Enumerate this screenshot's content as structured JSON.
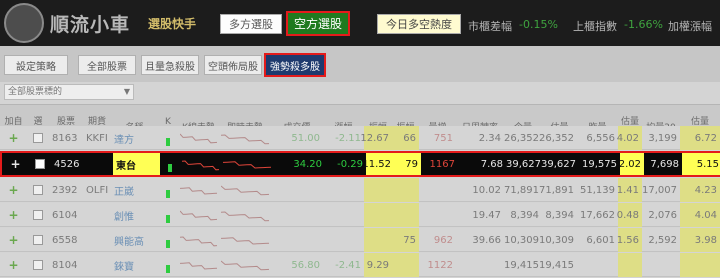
{
  "app": {
    "title": "順流小車",
    "subtitle": "選股快手"
  },
  "header": {
    "long_label": "多方選股",
    "short_label": "空方選股",
    "today_label": "今日多空熱度",
    "market_label": "市櫃差幅",
    "market_value": "-0.15%",
    "trade_label": "上櫃指數",
    "trade_value": "-1.66%",
    "extra_label": "加權漲幅"
  },
  "strategies": [
    {
      "label": "設定策略"
    },
    {
      "label": "全部股票"
    },
    {
      "label": "且量急殺股"
    },
    {
      "label": "空頭佈局股"
    },
    {
      "label": "強勢殺多股"
    }
  ],
  "filter": {
    "label": "全部股票標的"
  },
  "columns": [
    {
      "l1": "加自",
      "l2": "選股"
    },
    {
      "l1": "選",
      "l2": "取"
    },
    {
      "l1": "股票",
      "l2": "代碼"
    },
    {
      "l1": "期貨",
      "l2": "代碼"
    },
    {
      "l1": "名稱",
      "l2": ""
    },
    {
      "l1": "K",
      "l2": "棒"
    },
    {
      "l1": "K線走勢",
      "l2": ""
    },
    {
      "l1": "即時走勢",
      "l2": ""
    },
    {
      "l1": "成交價",
      "l2": ""
    },
    {
      "l1": "漲幅",
      "l2": ""
    },
    {
      "l1": "振幅",
      "l2": ""
    },
    {
      "l1": "振幅",
      "l2": ""
    },
    {
      "l1": "量增",
      "l2": ""
    },
    {
      "l1": "日周轉率",
      "l2": ""
    },
    {
      "l1": "今量",
      "l2": ""
    },
    {
      "l1": "估量",
      "l2": ""
    },
    {
      "l1": "昨量",
      "l2": ""
    },
    {
      "l1": "估量",
      "l2": "昨比"
    },
    {
      "l1": "均量20",
      "l2": ""
    },
    {
      "l1": "估量",
      "l2": "20MA比"
    }
  ],
  "rows": [
    {
      "code": "8163",
      "fut": "KKFI",
      "name": "達方",
      "price": "51.00",
      "chg": "-2.11",
      "amp1": "12.67",
      "amp2": "66",
      "vol_inc": "751",
      "turnover": "2.34",
      "vol_today": "26,352",
      "vol_est": "26,352",
      "vol_yday": "6,556",
      "ratio1": "4.02",
      "ma20": "3,199",
      "ratio2": "6.72",
      "selected": false
    },
    {
      "code": "4526",
      "fut": "",
      "name": "東台",
      "price": "34.20",
      "chg": "-0.29",
      "amp1": "11.52",
      "amp2": "79",
      "vol_inc": "1167",
      "turnover": "7.68",
      "vol_today": "39,627",
      "vol_est": "39,627",
      "vol_yday": "19,575",
      "ratio1": "2.02",
      "ma20": "7,698",
      "ratio2": "5.15",
      "selected": true
    },
    {
      "code": "2392",
      "fut": "OLFI",
      "name": "正崴",
      "price": "",
      "chg": "",
      "amp1": "",
      "amp2": "",
      "vol_inc": "",
      "turnover": "10.02",
      "vol_today": "71,891",
      "vol_est": "71,891",
      "vol_yday": "51,139",
      "ratio1": "1.41",
      "ma20": "17,007",
      "ratio2": "4.23",
      "selected": false
    },
    {
      "code": "6104",
      "fut": "",
      "name": "創惟",
      "price": "",
      "chg": "",
      "amp1": "",
      "amp2": "",
      "vol_inc": "",
      "turnover": "19.47",
      "vol_today": "8,394",
      "vol_est": "8,394",
      "vol_yday": "17,662",
      "ratio1": "0.48",
      "ma20": "2,076",
      "ratio2": "4.04",
      "selected": false
    },
    {
      "code": "6558",
      "fut": "",
      "name": "興能高",
      "price": "",
      "chg": "",
      "amp1": "",
      "amp2": "75",
      "vol_inc": "962",
      "turnover": "39.66",
      "vol_today": "10,309",
      "vol_est": "10,309",
      "vol_yday": "6,601",
      "ratio1": "1.56",
      "ma20": "2,592",
      "ratio2": "3.98",
      "selected": false
    },
    {
      "code": "8104",
      "fut": "",
      "name": "錸寶",
      "price": "56.80",
      "chg": "-2.41",
      "amp1": "9.29",
      "amp2": "",
      "vol_inc": "1122",
      "turnover": "",
      "vol_today": "19,415",
      "vol_est": "19,415",
      "vol_yday": "",
      "ratio1": "",
      "ma20": "",
      "ratio2": "",
      "selected": false
    }
  ]
}
